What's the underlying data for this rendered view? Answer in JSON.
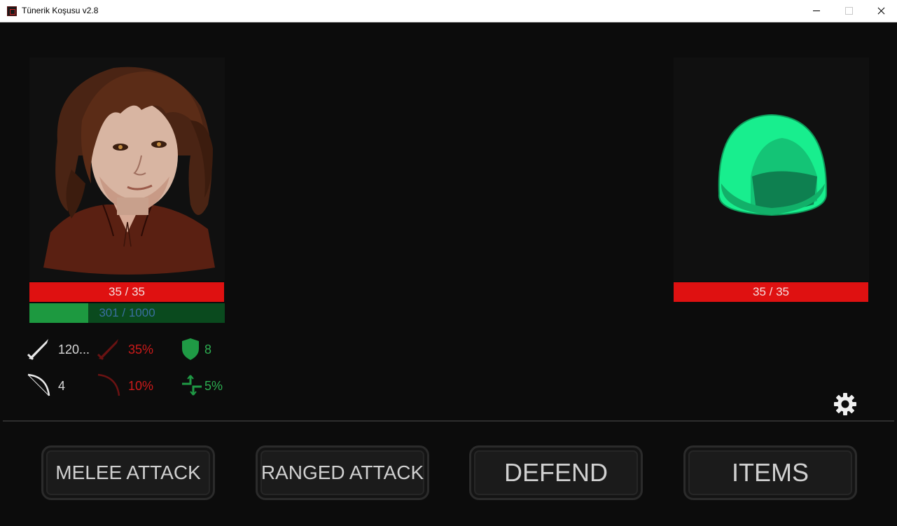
{
  "window": {
    "title": "Tünerik Koşusu v2.8"
  },
  "hero": {
    "hp_text": "35 / 35",
    "hp_fraction": 1.0,
    "xp_text": "301 / 1000",
    "xp_fraction": 0.301
  },
  "enemy": {
    "hp_text": "35 / 35",
    "hp_fraction": 1.0
  },
  "stats": {
    "melee_damage": "120...",
    "melee_crit": "35%",
    "armor": "8",
    "ranged_damage": "4",
    "ranged_crit": "10%",
    "dodge": "5%"
  },
  "actions": {
    "melee": "MELEE ATTACK",
    "ranged": "RANGED ATTACK",
    "defend": "DEFEND",
    "items": "ITEMS"
  },
  "colors": {
    "hp_bar": "#df1111",
    "xp_fill": "#1d9940",
    "xp_track": "#0a4a1e",
    "slime": "#18ee8e",
    "background": "#0c0c0c"
  },
  "icons": [
    "sword-icon",
    "crit-sword-icon",
    "shield-icon",
    "bow-icon",
    "crit-bow-icon",
    "dodge-arrows-icon",
    "gear-icon"
  ]
}
